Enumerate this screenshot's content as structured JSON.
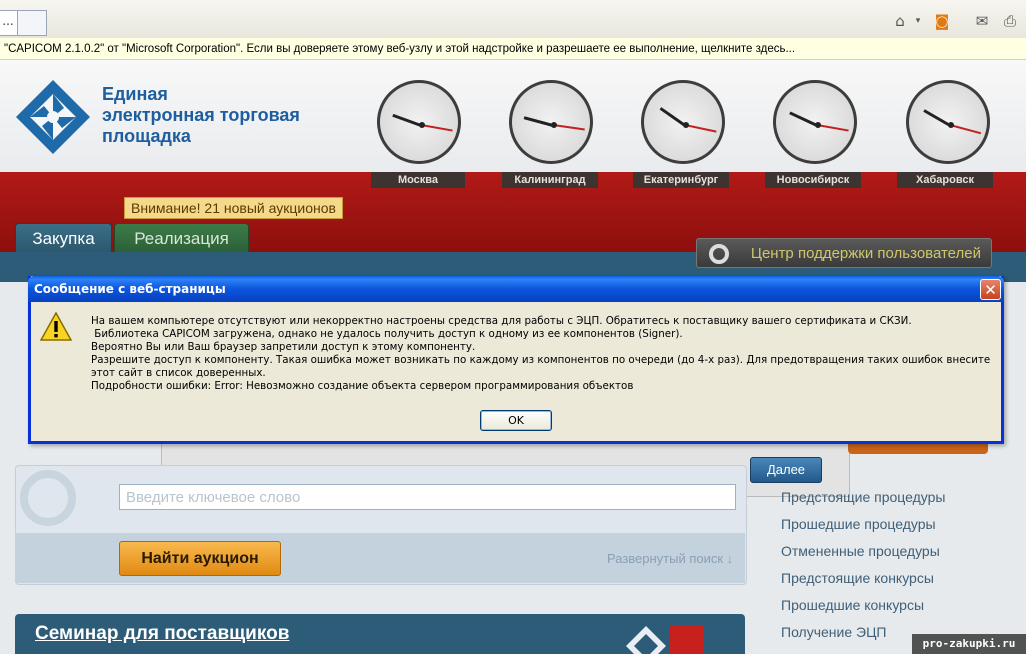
{
  "browser": {
    "tab_label": "...",
    "info_bar": "\"CAPICOM 2.1.0.2\" от \"Microsoft Corporation\". Если вы доверяете этому веб-узлу и этой надстройке и разрешаете ее выполнение, щелкните здесь...",
    "icons": [
      "home-icon",
      "rss-icon",
      "mail-icon",
      "print-icon"
    ]
  },
  "site": {
    "logo_lines": [
      "Единая",
      "электронная торговая",
      "площадка"
    ],
    "clocks": [
      {
        "city": "Москва"
      },
      {
        "city": "Калининград"
      },
      {
        "city": "Екатеринбург"
      },
      {
        "city": "Новосибирск"
      },
      {
        "city": "Хабаровск"
      }
    ],
    "notice": "Внимание! 21 новый аукционов",
    "tabs": [
      "Закупка",
      "Реализация"
    ],
    "support_button": "Центр поддержки пользователей",
    "search_placeholder": "Введите ключевое слово",
    "find_button": "Найти аукцион",
    "advanced_search": "Развернутый поиск ↓",
    "next_button": "Далее",
    "right_links": [
      "Предстоящие процедуры",
      "Прошедшие процедуры",
      "Отмененные процедуры",
      "Предстоящие конкурсы",
      "Прошедшие конкурсы",
      "Получение ЭЦП"
    ],
    "seminar_title": "Семинар для поставщиков",
    "watermark": "pro-zakupki.ru"
  },
  "dialog": {
    "title": "Сообщение с веб-страницы",
    "lines": [
      "На вашем компьютере отсутствуют или некорректно настроены средства для работы с ЭЦП. Обратитесь к поставщику вашего сертификата и СКЗИ.",
      " Библиотека CAPICOM загружена, однако не удалось получить доступ к одному из ее компонентов (Signer).",
      "Вероятно Вы или Ваш браузер запретили доступ к этому компоненту.",
      "Разрешите доступ к компоненту. Такая ошибка может возникать по каждому из компонентов по очереди (до 4-х раз). Для предотвращения таких ошибок внесите этот сайт в список доверенных.",
      "Подробности ошибки: Error: Невозможно создание объекта сервером программирования объектов"
    ],
    "ok_label": "OK"
  },
  "colors": {
    "dialog_titlebar": "#0b55dd",
    "header_red": "#b11a17",
    "accent_blue": "#2c5c78",
    "find_orange": "#e08a12"
  }
}
